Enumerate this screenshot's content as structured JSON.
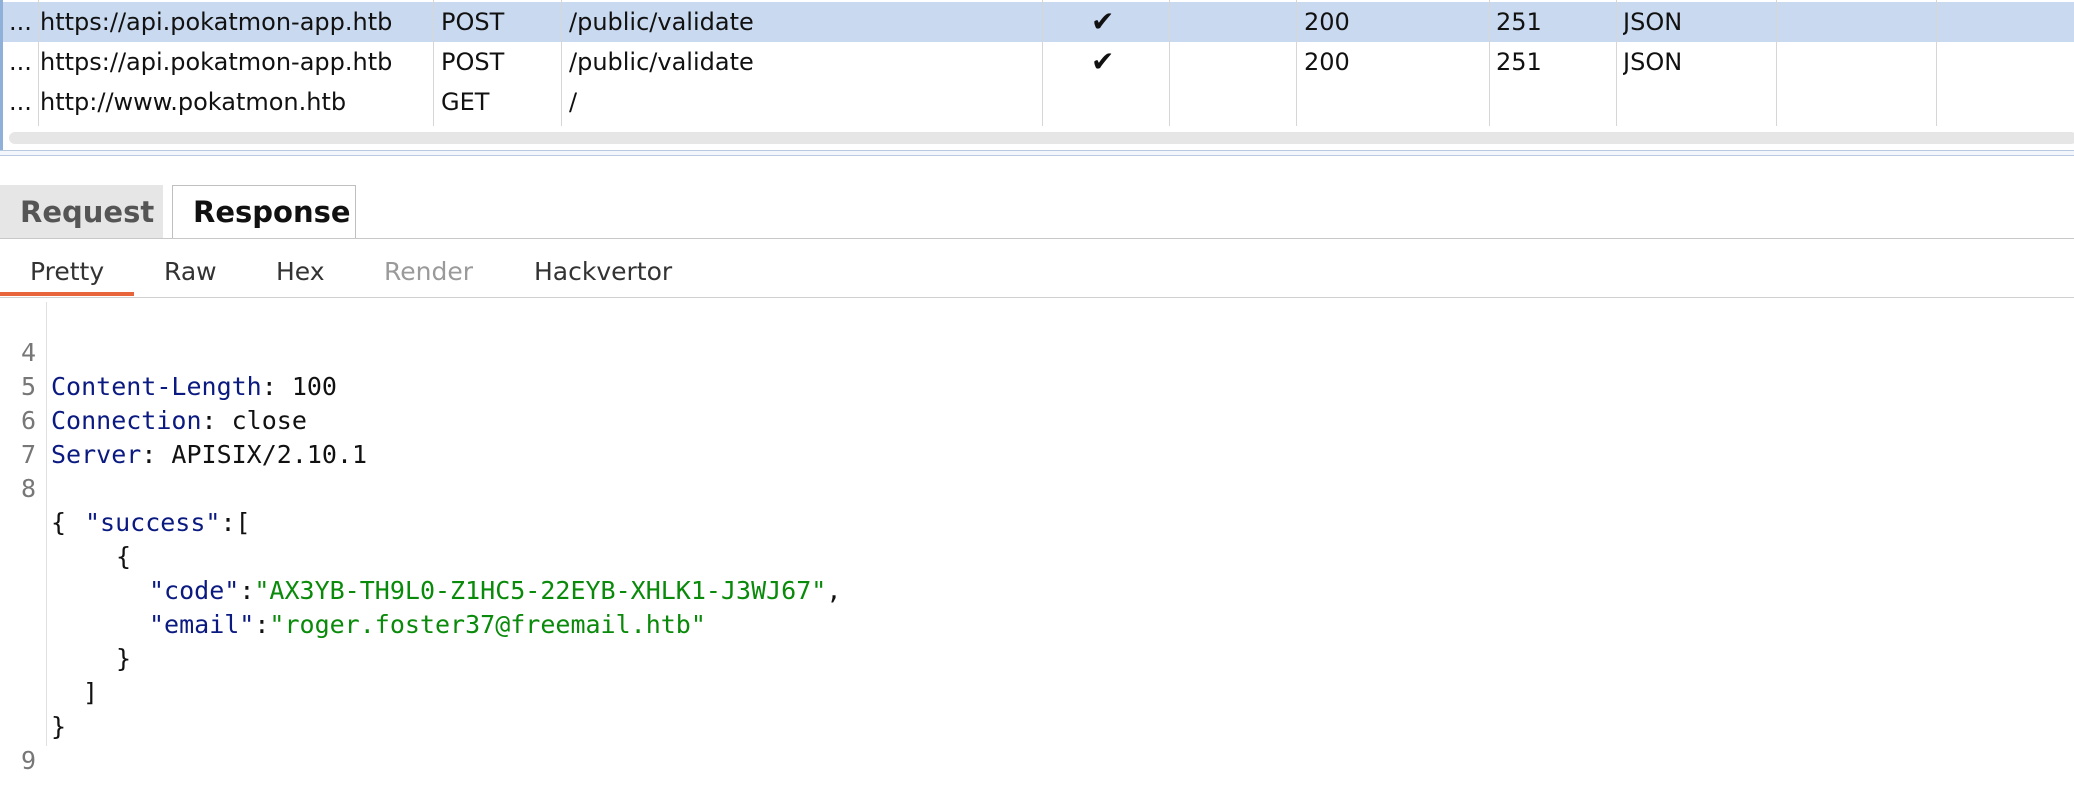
{
  "history": {
    "rows": [
      {
        "dots": "...",
        "host": "https://api.pokatmon-app.htb",
        "method": "POST",
        "url": "/public/validate",
        "check": "✔",
        "status": "200",
        "length": "251",
        "mime": "JSON",
        "selected": true
      },
      {
        "dots": "...",
        "host": "https://api.pokatmon-app.htb",
        "method": "POST",
        "url": "/public/validate",
        "check": "✔",
        "status": "200",
        "length": "251",
        "mime": "JSON",
        "selected": false
      },
      {
        "dots": "...",
        "host": "http://www.pokatmon.htb",
        "method": "GET",
        "url": "/",
        "check": "",
        "status": "",
        "length": "",
        "mime": "",
        "selected": false
      }
    ]
  },
  "tabs": {
    "request": "Request",
    "response": "Response",
    "active": "Response"
  },
  "subtabs": {
    "pretty": "Pretty",
    "raw": "Raw",
    "hex": "Hex",
    "render": "Render",
    "hackvertor": "Hackvertor",
    "active": "Pretty"
  },
  "code": {
    "line4": {
      "num": "4",
      "key": "Content-Length",
      "sep": ": ",
      "val": "100"
    },
    "line5": {
      "num": "5",
      "key": "Connection",
      "sep": ": ",
      "val": "close"
    },
    "line6": {
      "num": "6",
      "key": "Server",
      "sep": ": ",
      "val": "APISIX/2.10.1"
    },
    "line7": {
      "num": "7"
    },
    "line8": {
      "num": "8",
      "text": "{"
    },
    "success_key": "\"success\"",
    "success_open": ":[",
    "obj_open": "{",
    "code_key": "\"code\"",
    "code_val": "\"AX3YB-TH9L0-Z1HC5-22EYB-XHLK1-J3WJ67\"",
    "code_comma": ",",
    "email_key": "\"email\"",
    "email_val": "\"roger.foster37@freemail.htb\"",
    "colon": ":",
    "obj_close": "}",
    "arr_close": "]",
    "root_close": "}",
    "line9": {
      "num": "9"
    }
  },
  "colors": {
    "selected_row": "#c9d9f0",
    "accent_underline": "#e8643a",
    "json_key": "#0b1a80",
    "json_string": "#0a8a0a"
  }
}
